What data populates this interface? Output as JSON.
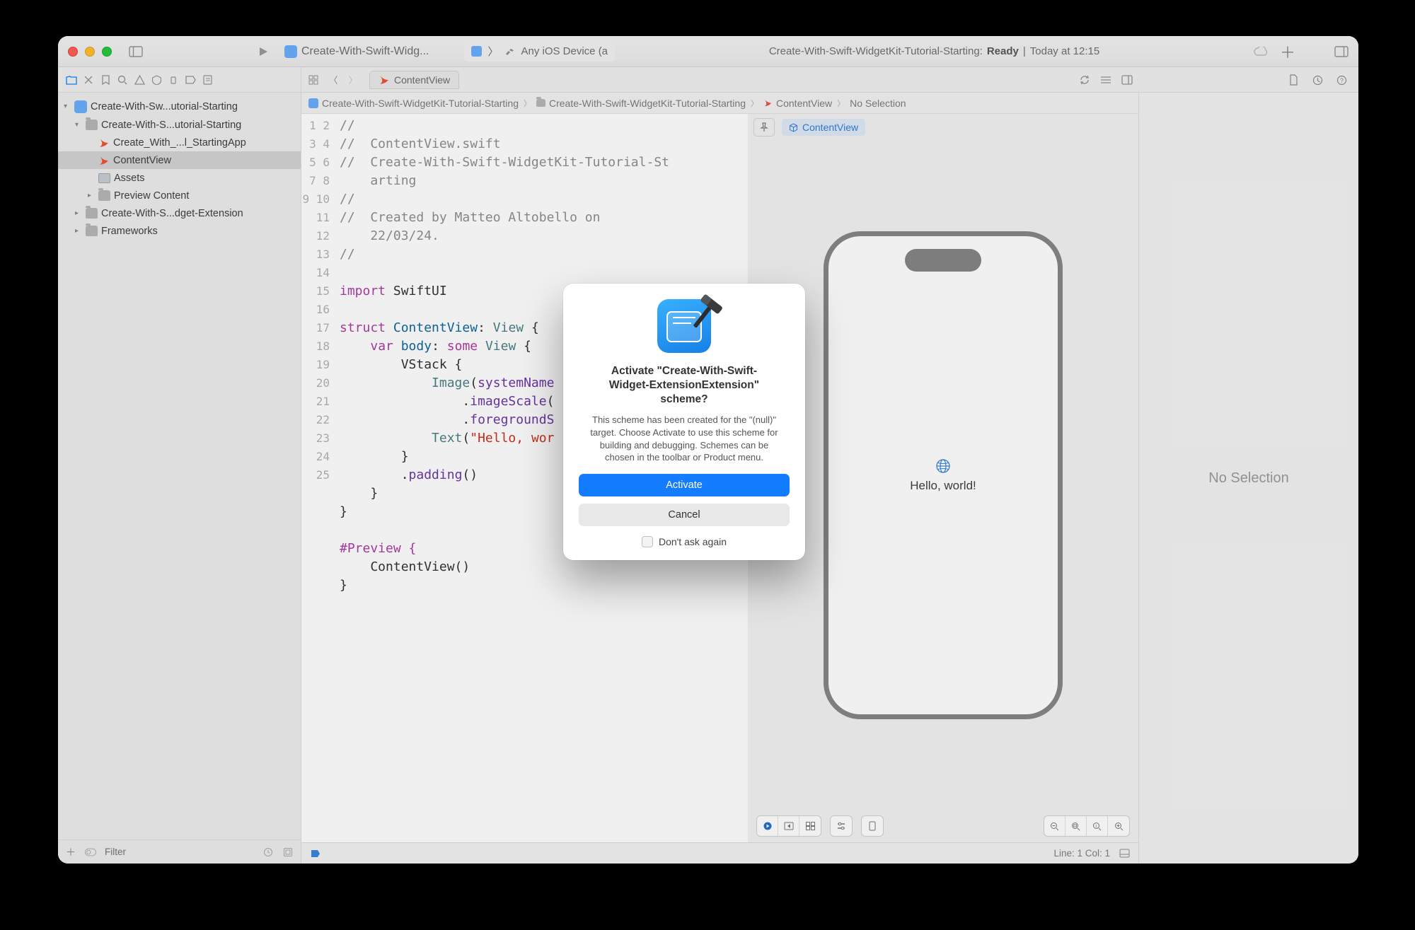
{
  "toolbar": {
    "title": "Create-With-Swift-Widg...",
    "device": "Any iOS Device (a",
    "status_project": "Create-With-Swift-WidgetKit-Tutorial-Starting: ",
    "status_state": "Ready",
    "status_sep": " | ",
    "status_time": "Today at 12:15"
  },
  "tabbar": {
    "filetab": "ContentView"
  },
  "breadcrumb": {
    "items": [
      "Create-With-Swift-WidgetKit-Tutorial-Starting",
      "Create-With-Swift-WidgetKit-Tutorial-Starting",
      "ContentView",
      "No Selection"
    ]
  },
  "nav": {
    "root": "Create-With-Sw...utorial-Starting",
    "target": "Create-With-S...utorial-Starting",
    "app": "Create_With_...l_StartingApp",
    "contentview": "ContentView",
    "assets": "Assets",
    "preview": "Preview Content",
    "ext": "Create-With-S...dget-Extension",
    "frameworks": "Frameworks",
    "filter_placeholder": "Filter"
  },
  "code": {
    "lines": {
      "l1": "//",
      "l2": "//  ContentView.swift",
      "l3a": "//  Create-With-Swift-WidgetKit-Tutorial-St",
      "l3b": "    arting",
      "l4": "//",
      "l5a": "//  Created by Matteo Altobello on",
      "l5b": "    22/03/24.",
      "l6": "//",
      "l8_kw": "import",
      "l8_sp": " ",
      "l8_mod": "SwiftUI",
      "l10_kw": "struct",
      "l10_name": " ContentView",
      "l10_colon": ": ",
      "l10_type": "View",
      "l10_brace": " {",
      "l11_a": "    ",
      "l11_kw": "var",
      "l11_sp": " ",
      "l11_body": "body",
      "l11_colon": ": ",
      "l11_some": "some",
      "l11_sp2": " ",
      "l11_view": "View",
      "l11_brace": " {",
      "l12": "        VStack {",
      "l13_a": "            ",
      "l13_img": "Image",
      "l13_lp": "(",
      "l13_arg": "systemName",
      "l14_a": "                .",
      "l14_fn": "imageScale",
      "l14_lp": "(",
      "l15_a": "                .",
      "l15_fn": "foregroundS",
      "l16_a": "            ",
      "l16_t": "Text",
      "l16_lp": "(",
      "l16_str": "\"Hello, wor",
      "l17": "        }",
      "l18_a": "        .",
      "l18_fn": "padding",
      "l18_c": "()",
      "l19": "    }",
      "l20": "}",
      "l22": "#Preview {",
      "l23": "    ContentView()",
      "l24": "}"
    }
  },
  "canvas": {
    "badge": "ContentView",
    "hello": "Hello, world!"
  },
  "inspector": {
    "placeholder": "No Selection"
  },
  "footer": {
    "line_col": "Line: 1  Col: 1"
  },
  "modal": {
    "heading": "Activate \"Create-With-Swift-Widget-ExtensionExtension\" scheme?",
    "body": "This scheme has been created for the \"(null)\" target. Choose Activate to use this scheme for building and debugging. Schemes can be chosen in the toolbar or Product menu.",
    "primary": "Activate",
    "secondary": "Cancel",
    "checkbox": "Don't ask again"
  }
}
